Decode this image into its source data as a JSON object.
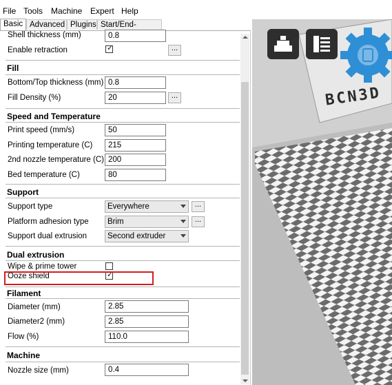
{
  "menu": [
    "File",
    "Tools",
    "Machine",
    "Expert",
    "Help"
  ],
  "tabs": [
    "Basic",
    "Advanced",
    "Plugins",
    "Start/End-GCode"
  ],
  "basic": {
    "shell_thickness": {
      "label": "Shell thickness (mm)",
      "value": "0.8"
    },
    "enable_retraction": {
      "label": "Enable retraction",
      "checked": true
    },
    "fill": {
      "header": "Fill",
      "bottom_top": {
        "label": "Bottom/Top thickness (mm)",
        "value": "0.8"
      },
      "density": {
        "label": "Fill Density (%)",
        "value": "20"
      }
    },
    "speed": {
      "header": "Speed and Temperature",
      "print_speed": {
        "label": "Print speed (mm/s)",
        "value": "50"
      },
      "print_temp": {
        "label": "Printing temperature (C)",
        "value": "215"
      },
      "nozzle2_temp": {
        "label": "2nd nozzle temperature (C)",
        "value": "200"
      },
      "bed_temp": {
        "label": "Bed temperature (C)",
        "value": "80"
      }
    },
    "support": {
      "header": "Support",
      "type": {
        "label": "Support type",
        "value": "Everywhere"
      },
      "adhesion": {
        "label": "Platform adhesion type",
        "value": "Brim"
      },
      "dual": {
        "label": "Support dual extrusion",
        "value": "Second extruder"
      }
    },
    "dual_extrusion": {
      "header": "Dual extrusion",
      "wipe": {
        "label": "Wipe & prime tower",
        "checked": false
      },
      "ooze": {
        "label": "Ooze shield",
        "checked": true
      }
    },
    "filament": {
      "header": "Filament",
      "diameter": {
        "label": "Diameter (mm)",
        "value": "2.85"
      },
      "diameter2": {
        "label": "Diameter2 (mm)",
        "value": "2.85"
      },
      "flow": {
        "label": "Flow (%)",
        "value": "110.0"
      }
    },
    "machine": {
      "header": "Machine",
      "nozzle": {
        "label": "Nozzle size (mm)",
        "value": "0.4"
      }
    },
    "more_button": "..."
  },
  "viewport": {
    "brand_text": "BCN3D",
    "colors": {
      "accent": "#2f8fd6",
      "button": "#2e2e2e",
      "highlight": "#d21d1d"
    }
  }
}
